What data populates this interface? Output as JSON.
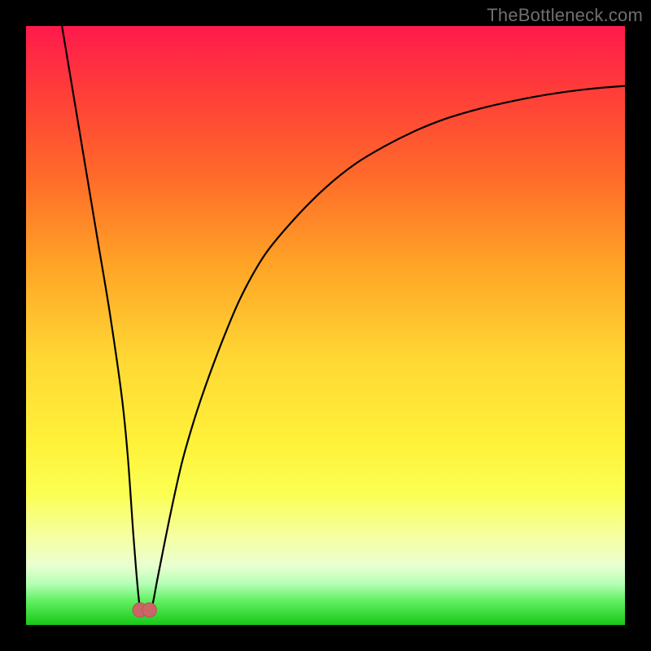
{
  "watermark": {
    "text": "TheBottleneck.com"
  },
  "colors": {
    "frame_bg": "#000000",
    "curve_stroke": "#000000",
    "marker_fill": "#cc6666",
    "marker_stroke": "#b35555"
  },
  "chart_data": {
    "type": "line",
    "title": "",
    "xlabel": "",
    "ylabel": "",
    "xlim": [
      0,
      100
    ],
    "ylim": [
      0,
      100
    ],
    "grid": false,
    "legend": false,
    "series": [
      {
        "name": "bottleneck-curve",
        "x": [
          6,
          8,
          10,
          12,
          14,
          16,
          17,
          18,
          19,
          20,
          21,
          22,
          24,
          26,
          28,
          30,
          33,
          36,
          40,
          45,
          50,
          55,
          60,
          65,
          70,
          75,
          80,
          85,
          90,
          95,
          100
        ],
        "values": [
          100,
          88,
          76,
          64,
          52,
          38,
          28,
          14,
          3,
          2,
          3,
          8,
          18,
          27,
          34,
          40,
          48,
          55,
          62,
          68,
          73,
          77,
          80,
          82.5,
          84.5,
          86,
          87.2,
          88.2,
          89,
          89.6,
          90
        ]
      }
    ],
    "markers": [
      {
        "name": "left-bump",
        "x": 19.0,
        "y": 2.5,
        "r": 1.2
      },
      {
        "name": "right-bump",
        "x": 20.6,
        "y": 2.5,
        "r": 1.2
      }
    ]
  }
}
